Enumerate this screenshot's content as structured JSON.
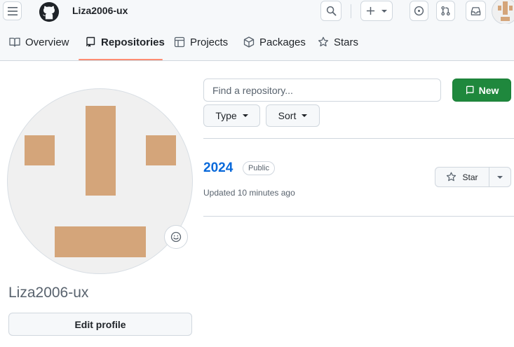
{
  "header": {
    "username": "Liza2006-ux"
  },
  "nav": {
    "tabs": [
      {
        "label": "Overview"
      },
      {
        "label": "Repositories"
      },
      {
        "label": "Projects"
      },
      {
        "label": "Packages"
      },
      {
        "label": "Stars"
      }
    ]
  },
  "repo_list": {
    "search_placeholder": "Find a repository...",
    "new_label": "New",
    "type_label": "Type",
    "sort_label": "Sort",
    "items": [
      {
        "name": "2024",
        "visibility": "Public",
        "updated": "Updated 10 minutes ago",
        "star_label": "Star"
      }
    ]
  },
  "profile": {
    "username": "Liza2006-ux",
    "edit_label": "Edit profile"
  },
  "colors": {
    "accent_link": "#0969da",
    "new_button": "#1f883d",
    "avatar_block": "#d4a57a",
    "tab_underline": "#fd8c73"
  }
}
